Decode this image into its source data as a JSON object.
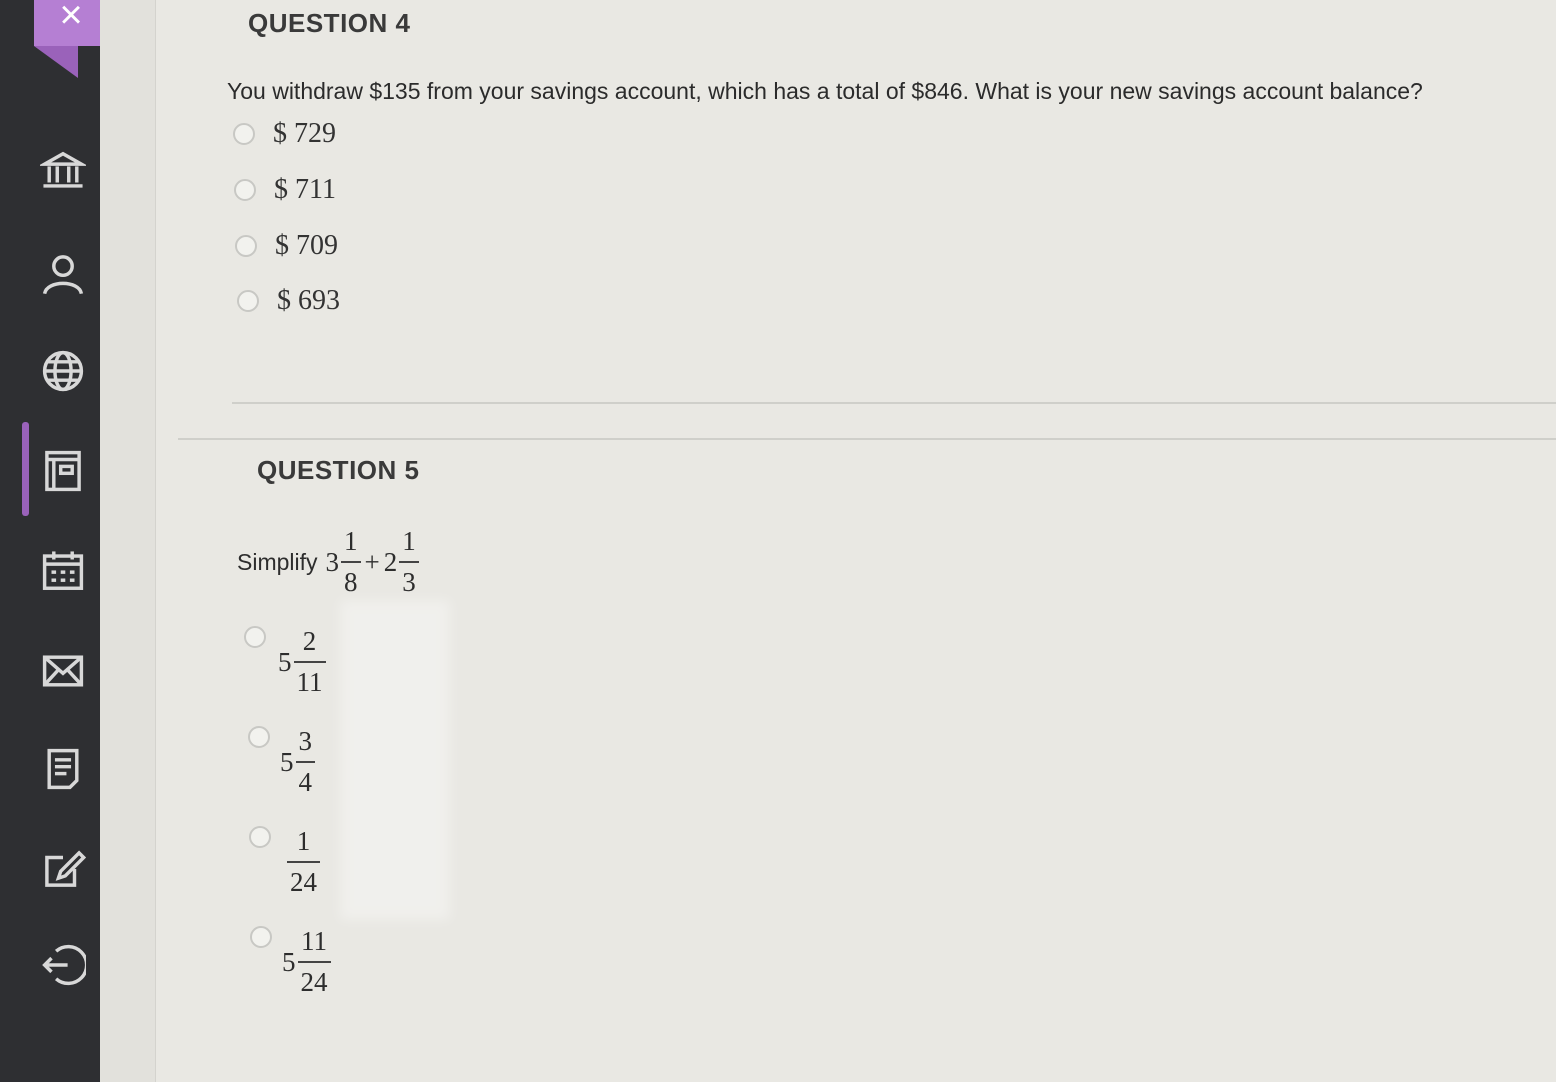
{
  "nav": {
    "close_glyph": "×",
    "icons": [
      "institution-icon",
      "user-icon",
      "globe-icon",
      "courses-icon",
      "calendar-icon",
      "mail-icon",
      "history-icon",
      "edit-icon",
      "logout-icon"
    ],
    "accent": "#b57fd3"
  },
  "question4": {
    "title": "QUESTION 4",
    "text": "You withdraw $135 from your savings account, which has a total of $846.  What is your new savings account balance?",
    "options": [
      "$ 729",
      "$ 711",
      "$ 709",
      "$ 693"
    ]
  },
  "question5": {
    "title": "QUESTION 5",
    "prompt_word": "Simplify",
    "expr": {
      "a_whole": "3",
      "a_num": "1",
      "a_den": "8",
      "op": "+",
      "b_whole": "2",
      "b_num": "1",
      "b_den": "3"
    },
    "options": [
      {
        "whole": "5",
        "num": "2",
        "den": "11"
      },
      {
        "whole": "5",
        "num": "3",
        "den": "4"
      },
      {
        "whole": "",
        "num": "1",
        "den": "24"
      },
      {
        "whole": "5",
        "num": "11",
        "den": "24"
      }
    ]
  }
}
